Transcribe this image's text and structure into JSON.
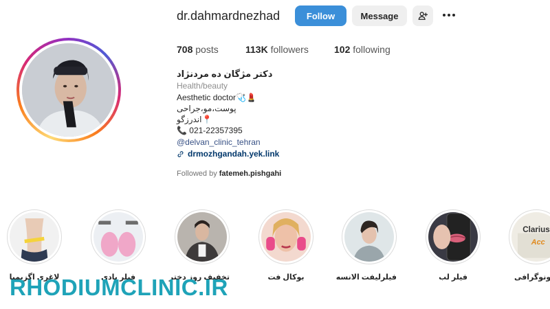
{
  "profile": {
    "username": "dr.dahmardnezhad",
    "follow_label": "Follow",
    "message_label": "Message"
  },
  "stats": {
    "posts_count": "708",
    "posts_label": "posts",
    "followers_count": "113K",
    "followers_label": "followers",
    "following_count": "102",
    "following_label": "following"
  },
  "bio": {
    "name": "دکتر مژگان ده مردنژاد",
    "category": "Health/beauty",
    "line1": "Aesthetic doctor🩺💄",
    "line2": "پوست،مو،جراحی",
    "line3": "اندرزگو📍",
    "line4": "📞 021-22357395",
    "handle": "@delvan_clinic_tehran",
    "link": "drmozhgandah.yek.link",
    "followed_prefix": "Followed by",
    "followed_user": "fatemeh.pishgahi"
  },
  "highlights": [
    {
      "label": "لاغری اگزیمیا",
      "color": "#e9a9c5"
    },
    {
      "label": "فیلر بادی",
      "color": "#f0a7c8"
    },
    {
      "label": "تخفیف روز دختر",
      "color": "#9a9590"
    },
    {
      "label": "بوکال فت",
      "color": "#e58fb4"
    },
    {
      "label": "فیلرلیفت الانسه",
      "color": "#b9c4c8"
    },
    {
      "label": "فیلر لب",
      "color": "#c9697d"
    },
    {
      "label": "سونوگرافی",
      "color": "#d7d4c8"
    }
  ],
  "highlight_clarius": {
    "brand": "Clarius",
    "sub": "Acc"
  },
  "watermark": "RHODIUMCLINIC.IR",
  "colors": {
    "follow_button": "#3b8fd9",
    "watermark": "#1fa3b8",
    "link": "#00376b"
  }
}
